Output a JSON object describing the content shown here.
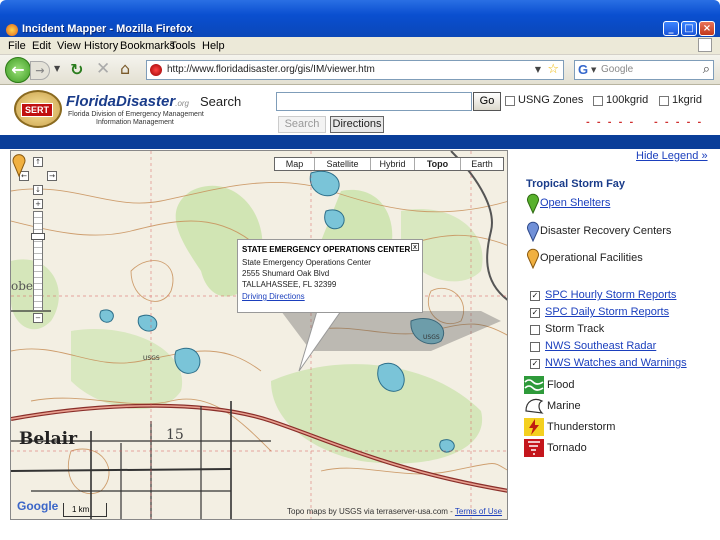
{
  "window": {
    "title": "Incident Mapper - Mozilla Firefox",
    "min_label": "_",
    "max_label": "□",
    "close_label": "×"
  },
  "menu": {
    "items": [
      "File",
      "Edit",
      "View",
      "History",
      "Bookmarks",
      "Tools",
      "Help"
    ]
  },
  "nav": {
    "url": "http://www.floridadisaster.org/gis/IM/viewer.htm",
    "search_placeholder": "Google",
    "search_engine_icon": "G"
  },
  "header": {
    "logo_badge": "SERT",
    "logo_name": "FloridaDisaster",
    "logo_suffix": ".org",
    "logo_sub": "Florida Division of Emergency Management",
    "logo_sub2": "Information Management",
    "search_label": "Search",
    "search_value": "",
    "go_label": "Go",
    "checkbox_usng": "USNG Zones",
    "checkbox_100k": "100kgrid",
    "checkbox_1k": "1kgrid",
    "tab_search": "Search",
    "tab_directions": "Directions",
    "dash_marks": "- - - - -"
  },
  "map": {
    "types": [
      "Map",
      "Satellite",
      "Hybrid",
      "Topo",
      "Earth"
    ],
    "active_type": "Topo",
    "place_belair": "Belair",
    "place_15": "15",
    "place_obe": "obe",
    "usgs_label": "USGS",
    "google_logo": "Google",
    "scale_label": "1 km",
    "attribution": "Topo maps by USGS via terraserver-usa.com",
    "terms": "Terms of Use",
    "popup": {
      "title": "STATE EMERGENCY OPERATIONS CENTER",
      "line1": "State Emergency Operations Center",
      "line2": "2555 Shumard Oak Blvd",
      "line3": "TALLAHASSEE, FL 32399",
      "link": "Driving Directions",
      "close": "x"
    },
    "pan_up": "↑",
    "pan_left": "←",
    "pan_right": "→",
    "pan_down": "↓",
    "zoom_in": "+",
    "zoom_out": "−"
  },
  "legend": {
    "hide_link": "Hide Legend »",
    "storm_title": "Tropical Storm Fay",
    "facilities": [
      {
        "label": "Open Shelters",
        "color": "#58b12c",
        "link": true
      },
      {
        "label": "Disaster Recovery Centers",
        "color": "#7090d8",
        "link": false
      },
      {
        "label": "Operational Facilities",
        "color": "#f0b040",
        "link": false
      }
    ],
    "layers": [
      {
        "label": "SPC Hourly Storm Reports",
        "checked": true,
        "link": true
      },
      {
        "label": "SPC Daily Storm Reports",
        "checked": true,
        "link": true
      },
      {
        "label": "Storm Track",
        "checked": false,
        "link": false
      },
      {
        "label": "NWS Southeast Radar",
        "checked": false,
        "link": true
      },
      {
        "label": "NWS Watches and Warnings",
        "checked": true,
        "link": true
      }
    ],
    "hazards": [
      {
        "label": "Flood",
        "icon": "flood-icon"
      },
      {
        "label": "Marine",
        "icon": "marine-icon"
      },
      {
        "label": "Thunderstorm",
        "icon": "thunderstorm-icon"
      },
      {
        "label": "Tornado",
        "icon": "tornado-icon"
      }
    ],
    "check_mark": "✓"
  }
}
